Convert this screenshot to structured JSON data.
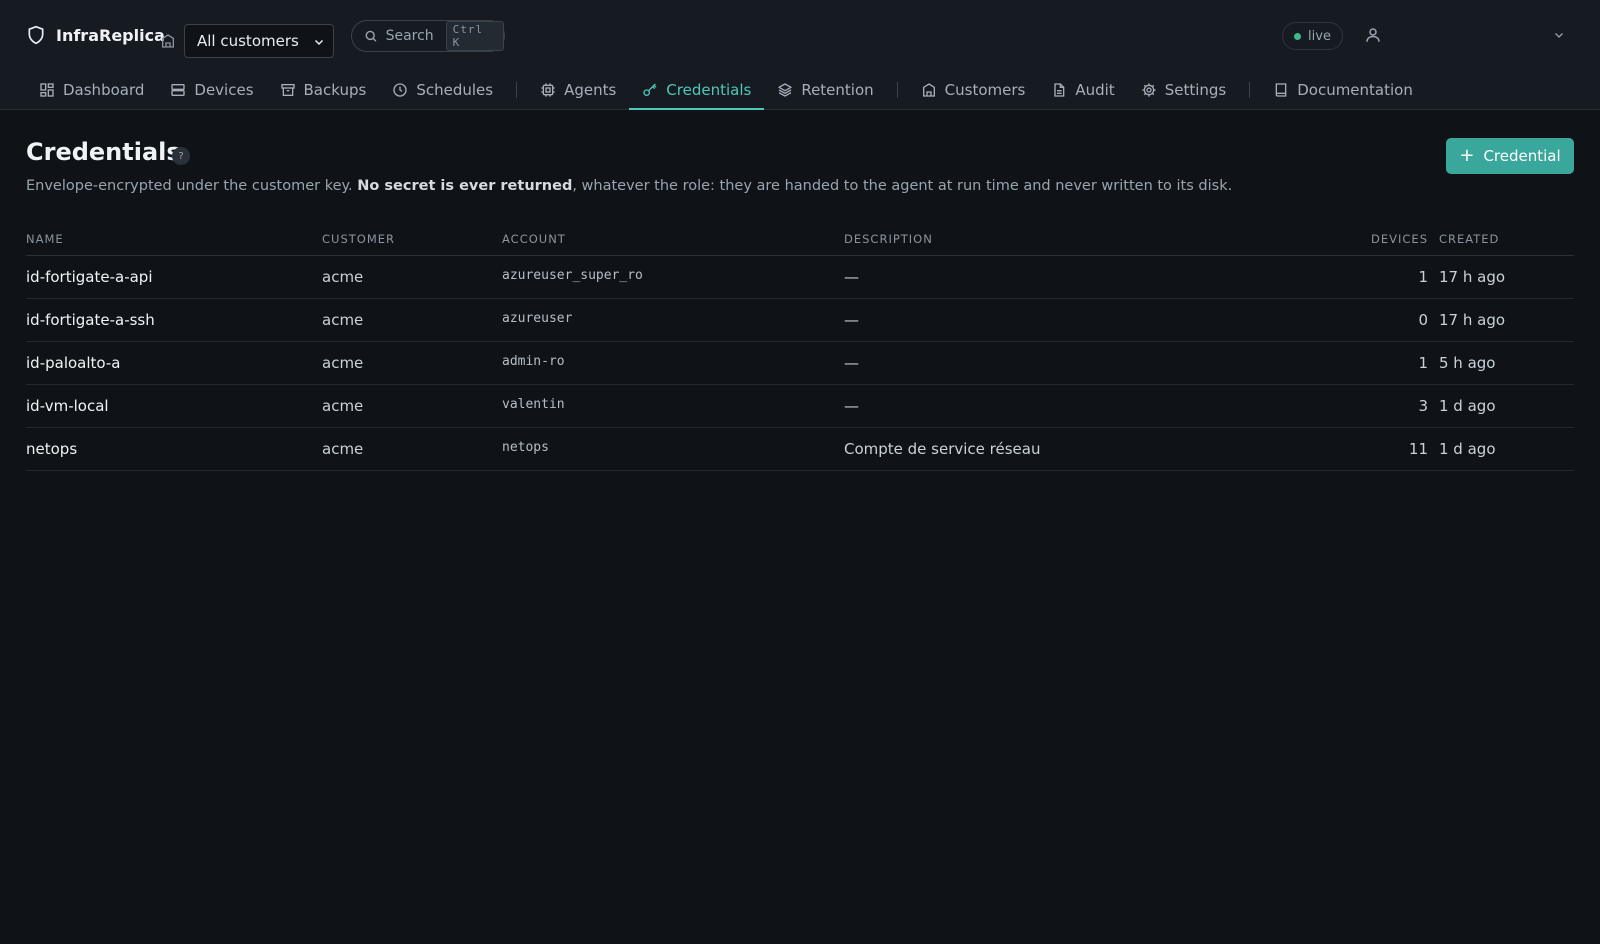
{
  "app": {
    "name": "InfraReplica",
    "customer_filter": "All customers",
    "search": {
      "label": "Search",
      "shortcut": "Ctrl K"
    },
    "status": "live"
  },
  "nav": {
    "items": [
      {
        "label": "Dashboard",
        "icon": "dashboard-icon"
      },
      {
        "label": "Devices",
        "icon": "server-icon"
      },
      {
        "label": "Backups",
        "icon": "archive-icon"
      },
      {
        "label": "Schedules",
        "icon": "clock-icon"
      },
      {
        "label": "Agents",
        "icon": "cpu-icon"
      },
      {
        "label": "Credentials",
        "icon": "key-icon",
        "active": true
      },
      {
        "label": "Retention",
        "icon": "layers-icon"
      },
      {
        "label": "Customers",
        "icon": "building-icon"
      },
      {
        "label": "Audit",
        "icon": "file-icon"
      },
      {
        "label": "Settings",
        "icon": "gear-icon"
      },
      {
        "label": "Documentation",
        "icon": "book-icon"
      }
    ]
  },
  "page": {
    "title": "Credentials",
    "help": "?",
    "add_button": "Credential",
    "subtitle_pre": "Envelope-encrypted under the customer key. ",
    "subtitle_bold": "No secret is ever returned",
    "subtitle_post": ", whatever the role: they are handed to the agent at run time and never written to its disk."
  },
  "table": {
    "headers": {
      "name": "NAME",
      "customer": "CUSTOMER",
      "account": "ACCOUNT",
      "description": "DESCRIPTION",
      "devices": "DEVICES",
      "created": "CREATED"
    },
    "rows": [
      {
        "name": "id-fortigate-a-api",
        "customer": "acme",
        "account": "azureuser_super_ro",
        "description": "—",
        "devices": "1",
        "created": "17 h ago"
      },
      {
        "name": "id-fortigate-a-ssh",
        "customer": "acme",
        "account": "azureuser",
        "description": "—",
        "devices": "0",
        "created": "17 h ago"
      },
      {
        "name": "id-paloalto-a",
        "customer": "acme",
        "account": "admin-ro",
        "description": "—",
        "devices": "1",
        "created": "5 h ago"
      },
      {
        "name": "id-vm-local",
        "customer": "acme",
        "account": "valentin",
        "description": "—",
        "devices": "3",
        "created": "1 d ago"
      },
      {
        "name": "netops",
        "customer": "acme",
        "account": "netops",
        "description": "Compte de service réseau",
        "devices": "11",
        "created": "1 d ago"
      }
    ]
  },
  "colors": {
    "accent": "#4fc7ba",
    "button": "#3aa79c",
    "background": "#0f1318",
    "live_dot": "#3fb98a"
  }
}
